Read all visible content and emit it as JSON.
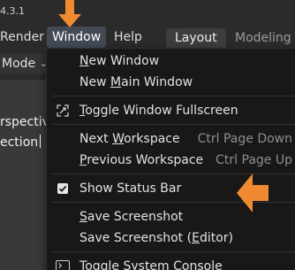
{
  "app": {
    "version": "4.3.1"
  },
  "menubar": {
    "render": "Render",
    "window": "Window",
    "help": "Help"
  },
  "workspaces": {
    "layout": "Layout",
    "modeling": "Modeling"
  },
  "viewport": {
    "mode": "Mode",
    "text_line1": "rspectiv",
    "text_line2": "ection"
  },
  "window_menu": {
    "new_window": {
      "u": "N",
      "rest": "ew Window"
    },
    "new_main_window": {
      "pre": "New ",
      "u": "M",
      "rest": "ain Window"
    },
    "toggle_fullscreen": {
      "u": "T",
      "rest": "oggle Window Fullscreen"
    },
    "next_workspace": {
      "pre": "Next ",
      "u": "W",
      "rest": "orkspace",
      "shortcut": "Ctrl Page Down"
    },
    "previous_workspace": {
      "u": "P",
      "rest": "revious Workspace",
      "shortcut": "Ctrl Page Up"
    },
    "show_status_bar": {
      "label": "Show Status Bar",
      "checked": true
    },
    "save_screenshot": {
      "u": "S",
      "rest": "ave Screenshot"
    },
    "save_screenshot_editor": {
      "pre": "Save Screenshot (",
      "u": "E",
      "rest": "ditor)"
    },
    "toggle_system_console": {
      "u": "T",
      "rest": "oggle System Console"
    }
  },
  "colors": {
    "arrow": "#f08a30",
    "menu_bg": "#181818",
    "highlight": "#444a55"
  },
  "icons": {
    "fullscreen": "fullscreen-icon",
    "checkbox": "checkbox-checked-icon",
    "console": "console-icon",
    "mode_caret": "chevron-down-icon"
  }
}
